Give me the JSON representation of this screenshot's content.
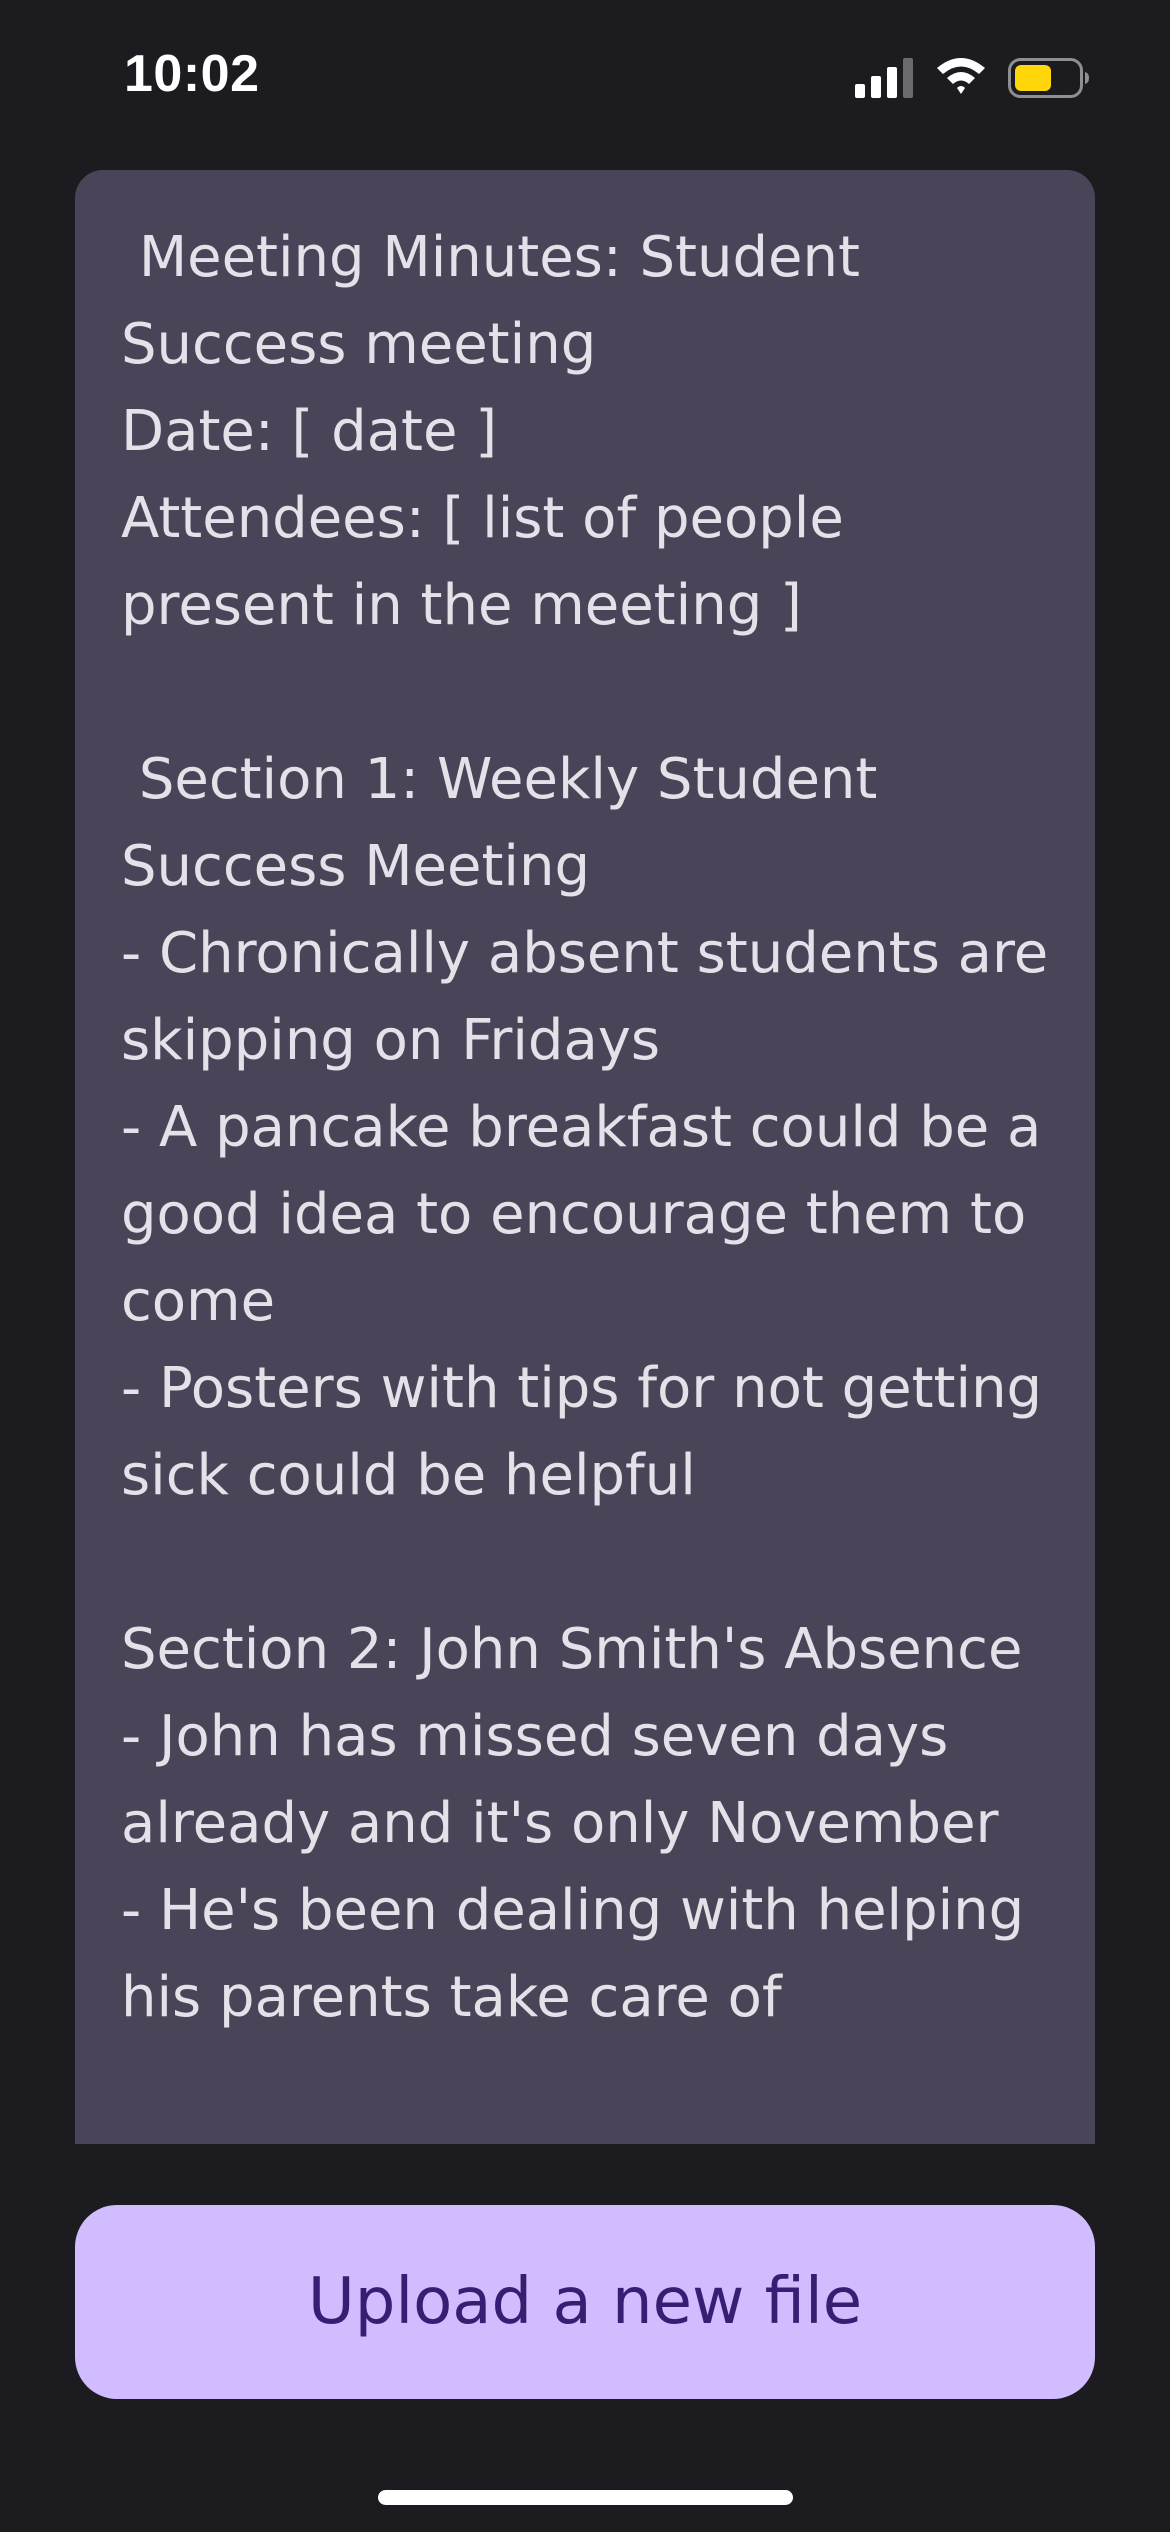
{
  "status_bar": {
    "time": "10:02",
    "icons": [
      "cellular-signal-icon",
      "wifi-icon",
      "battery-icon"
    ],
    "battery_color": "#ffd60a"
  },
  "notes": {
    "text": " Meeting Minutes: Student Success meeting\nDate: [ date ]\nAttendees: [ list of people present in the meeting ]\n\n Section 1: Weekly Student Success Meeting\n- Chronically absent students are skipping on Fridays\n- A pancake breakfast could be a good idea to encourage them to come\n- Posters with tips for not getting sick could be helpful\n\nSection 2: John Smith's Absence\n- John has missed seven days already and it's only November\n- He's been dealing with helping his parents take care of"
  },
  "actions": {
    "upload_label": "Upload a new file"
  },
  "colors": {
    "background": "#1c1b1f",
    "card": "#4a4458",
    "card_text": "#e6e0e9",
    "button_bg": "#d0bcff",
    "button_text": "#381e72"
  }
}
